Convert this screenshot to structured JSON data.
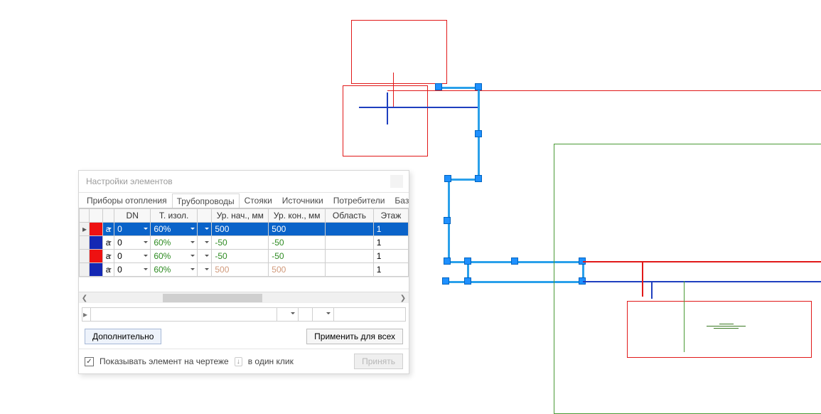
{
  "panel": {
    "title": "Настройки элементов",
    "tabs": [
      "Приборы отопления",
      "Трубопроводы",
      "Стояки",
      "Источники",
      "Потребители",
      "Базовые то"
    ],
    "active_tab": 1,
    "grid": {
      "headers": [
        "",
        "",
        "",
        "DN",
        "",
        "Т. изол.",
        "",
        "Ур. нач., мм",
        "Ур. кон., мм",
        "Область",
        "Этаж"
      ],
      "rows": [
        {
          "selected": true,
          "swatch": "#e11",
          "a": "а",
          "dn": "0",
          "tizol": "60%",
          "lvl_start": "500",
          "lvl_end": "500",
          "region": "",
          "floor": "1"
        },
        {
          "selected": false,
          "swatch": "#1428b4",
          "a": "а",
          "dn": "0",
          "tizol": "60%",
          "lvl_start": "-50",
          "lvl_end": "-50",
          "region": "",
          "floor": "1"
        },
        {
          "selected": false,
          "swatch": "#e11",
          "a": "а",
          "dn": "0",
          "tizol": "60%",
          "lvl_start": "-50",
          "lvl_end": "-50",
          "region": "",
          "floor": "1"
        },
        {
          "selected": false,
          "swatch": "#1428b4",
          "a": "а",
          "dn": "0",
          "tizol": "60%",
          "lvl_start": "500",
          "lvl_end": "500",
          "region": "",
          "floor": "1",
          "faded": true
        }
      ]
    },
    "buttons": {
      "more": "Дополнительно",
      "apply_all": "Применить для всех",
      "accept": "Принять"
    },
    "footer": {
      "checkbox_label": "Показывать элемент на чертеже",
      "one_click": "в один клик"
    }
  }
}
